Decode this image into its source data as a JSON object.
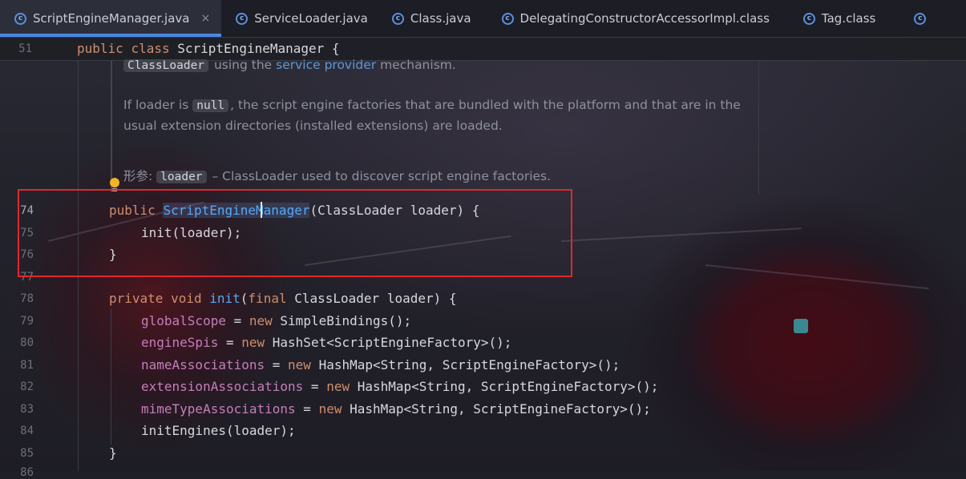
{
  "tabs": [
    {
      "label": "ScriptEngineManager.java",
      "active": true,
      "icon": "class-icon"
    },
    {
      "label": "ServiceLoader.java",
      "icon": "class-icon"
    },
    {
      "label": "Class.java",
      "icon": "class-icon"
    },
    {
      "label": "DelegatingConstructorAccessorImpl.class",
      "icon": "class-icon"
    },
    {
      "label": "Tag.class",
      "icon": "class-icon"
    }
  ],
  "close_glyph": "×",
  "sticky": {
    "line": "51",
    "kw1": "public",
    "kw2": "class",
    "name": "ScriptEngineManager",
    "brace": " {"
  },
  "doc": {
    "line1_chip": "ClassLoader",
    "line1_a": " using the ",
    "line1_link": "service provider",
    "line1_b": " mechanism.",
    "line2_a": "If loader is ",
    "line2_chip": "null",
    "line2_b": ", the script engine factories that are bundled with the platform and that are in the",
    "line3": "usual extension directories (installed extensions) are loaded.",
    "param_label": "形参: ",
    "param_chip": "loader",
    "param_desc": " – ClassLoader used to discover script engine factories."
  },
  "lines": {
    "n74": "74",
    "n75": "75",
    "n76": "76",
    "n77": "77",
    "n78": "78",
    "n79": "79",
    "n80": "80",
    "n81": "81",
    "n82": "82",
    "n83": "83",
    "n84": "84",
    "n85": "85",
    "n86": "86"
  },
  "code": {
    "l74_kw": "public",
    "l74_fn": "ScriptEngineManager",
    "l74_rest": "(ClassLoader loader) {",
    "l75": "init(loader);",
    "l76": "}",
    "l78_kw1": "private",
    "l78_kw2": "void",
    "l78_fn": "init",
    "l78_a": "(",
    "l78_kw3": "final",
    "l78_rest": " ClassLoader loader) {",
    "l79_f": "globalScope",
    "l79_eq": " = ",
    "l79_new": "new",
    "l79_rest": " SimpleBindings();",
    "l80_f": "engineSpis",
    "l80_eq": " = ",
    "l80_new": "new",
    "l80_rest": " HashSet<ScriptEngineFactory>();",
    "l81_f": "nameAssociations",
    "l81_eq": " = ",
    "l81_new": "new",
    "l81_rest": " HashMap<String, ScriptEngineFactory>();",
    "l82_f": "extensionAssociations",
    "l82_eq": " = ",
    "l82_new": "new",
    "l82_rest": " HashMap<String, ScriptEngineFactory>();",
    "l83_f": "mimeTypeAssociations",
    "l83_eq": " = ",
    "l83_new": "new",
    "l83_rest": " HashMap<String, ScriptEngineFactory>();",
    "l84": "initEngines(loader);",
    "l85": "}"
  },
  "colors": {
    "keyword": "#cf8e6d",
    "function": "#56a8f5",
    "field": "#c77dbb",
    "text": "#d6d8de",
    "highlight_box": "#e0282e",
    "tab_accent": "#4a88e8"
  }
}
